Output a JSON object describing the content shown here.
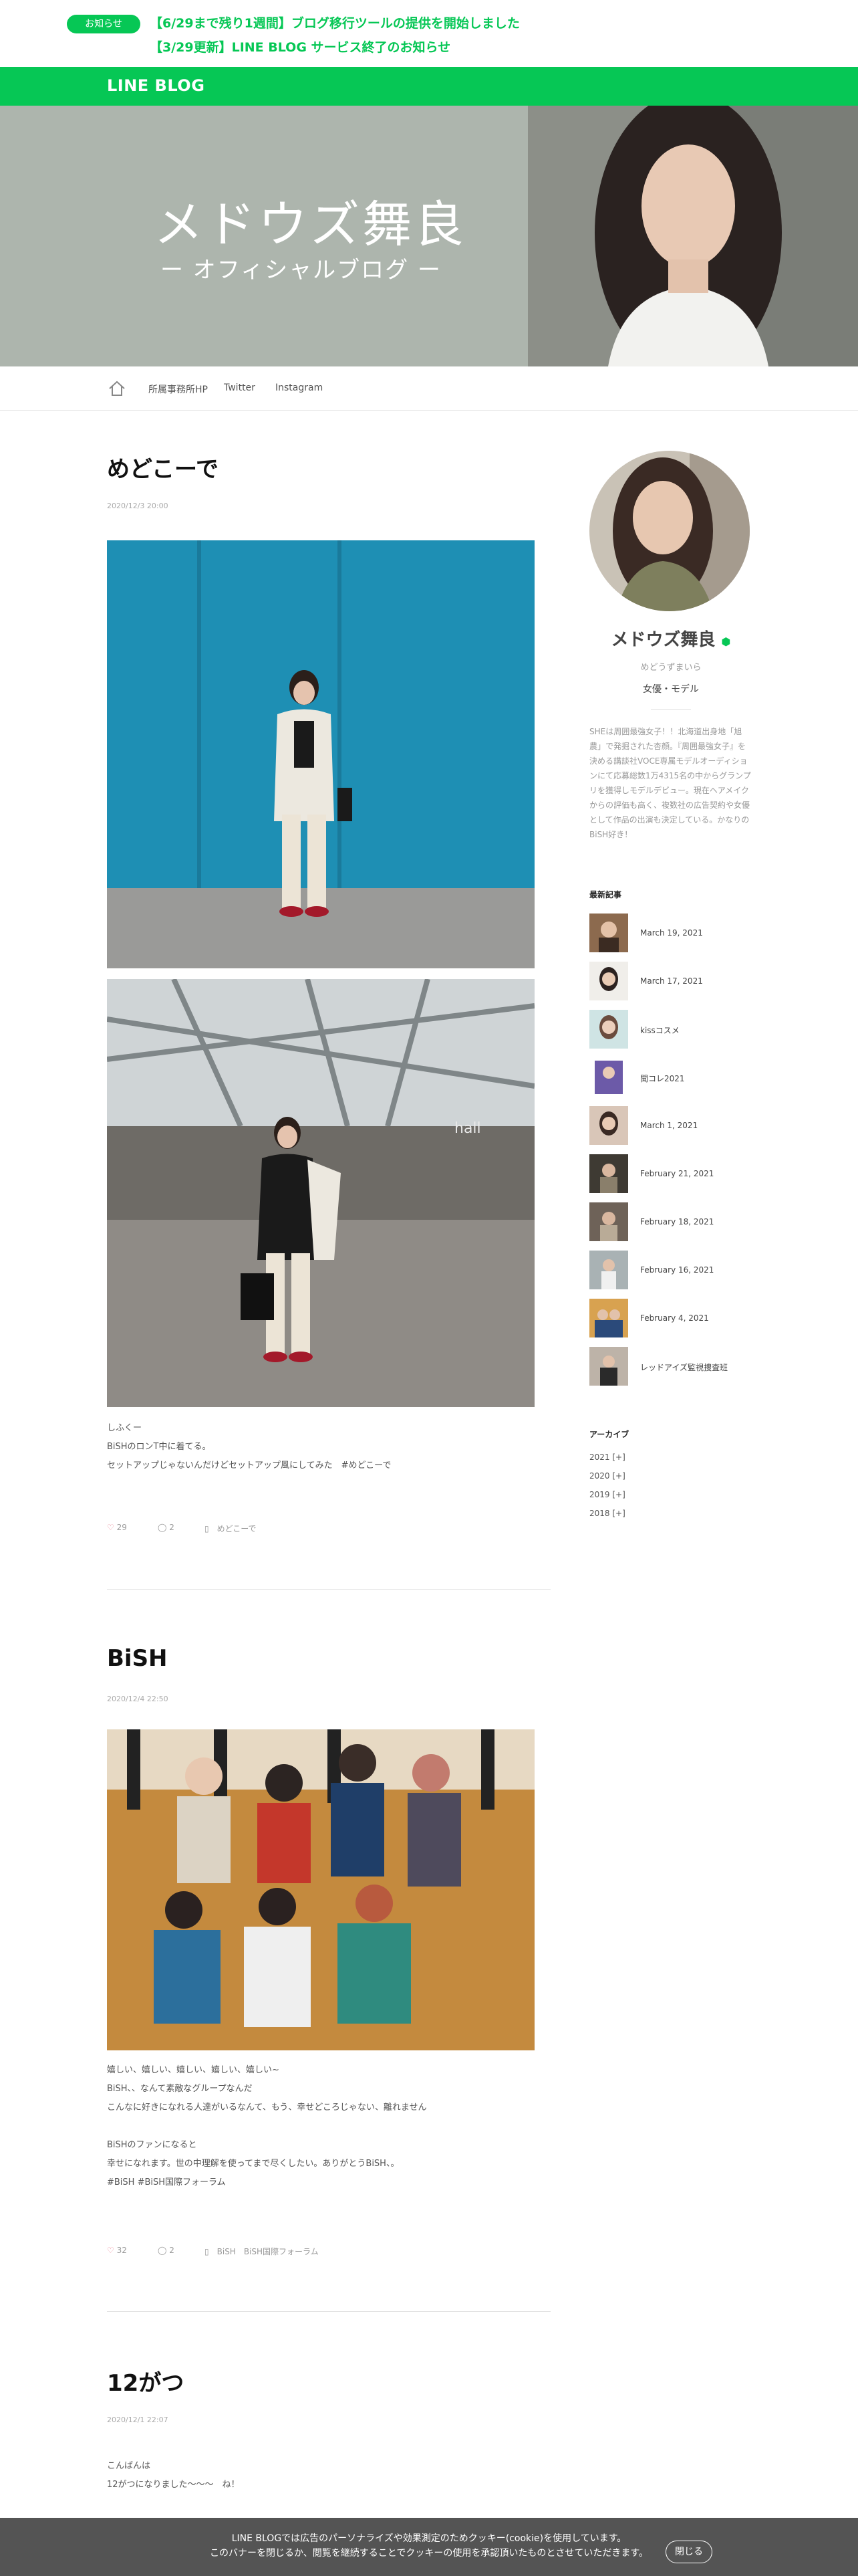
{
  "notice": {
    "badge": "お知らせ",
    "line1": "【6/29まで残り1週間】ブログ移行ツールの提供を開始しました",
    "line2": "【3/29更新】LINE BLOG サービス終了のお知らせ"
  },
  "header": {
    "logo": "LINE BLOG"
  },
  "hero": {
    "title": "メドウズ舞良",
    "subtitle": "ー オフィシャルブログ ー",
    "bg_color": "#adb5ad"
  },
  "nav": {
    "home_icon": "home-icon",
    "links": [
      "所属事務所HP",
      "Twitter",
      "Instagram"
    ]
  },
  "posts": [
    {
      "title": "めどこーで",
      "date": "2020/12/3 20:00",
      "text": [
        "しふくー",
        "BiSHのロンT中に着てる。",
        "セットアップじゃないんだけどセットアップ風にしてみた　#めどこーで"
      ],
      "likes": "29",
      "comments": "2",
      "tags": "めどこーで"
    },
    {
      "title": "BiSH",
      "date": "2020/12/4 22:50",
      "text": [
        "嬉しい、嬉しい、嬉しい、嬉しい、嬉しい~",
        "BiSH、、なんて素敵なグループなんだ",
        "こんなに好きになれる人達がいるなんて、もう、幸せどころじゃない、離れません",
        "",
        "BiSHのファンになると",
        "幸せになれます。世の中理解を使ってまで尽くしたい。ありがとうBiSH、。",
        "#BiSH #BiSH国際フォーラム"
      ],
      "likes": "32",
      "comments": "2",
      "tags": "BiSH　BiSH国際フォーラム"
    },
    {
      "title": "12がつ",
      "date": "2020/12/1 22:07",
      "text": [
        "こんばんは",
        "12がつになりました〜〜〜　ね！"
      ]
    }
  ],
  "profile": {
    "name": "メドウズ舞良",
    "kana": "めどうずまいら",
    "category": "女優・モデル",
    "description": "SHEは周囲最強女子！！北海道出身地「旭農」で発掘された杏顔。『周囲最強女子』を決める講談社VOCE専属モデルオーディションにて応募総数1万4315名の中からグランプリを獲得しモデルデビュー。現在ヘアメイクからの評価も高く、複数社の広告契約や女優として作品の出演も決定している。かなりのBiSH好き！"
  },
  "recent": {
    "heading": "最新記事",
    "items": [
      "March 19, 2021",
      "March 17, 2021",
      "kissコスメ",
      "聞コレ2021",
      "March 1, 2021",
      "February 21, 2021",
      "February 18, 2021",
      "February 16, 2021",
      "February 4, 2021",
      "レッドアイズ監視捜査班"
    ]
  },
  "archive": {
    "heading": "アーカイブ",
    "items": [
      "2021 [+]",
      "2020 [+]",
      "2019 [+]",
      "2018 [+]"
    ]
  },
  "cookie": {
    "line1": "LINE BLOGでは広告のパーソナライズや効果測定のためクッキー(cookie)を使用しています。",
    "line2": "このバナーを閉じるか、閲覧を継続することでクッキーの使用を承認頂いたものとさせていただきます。",
    "close": "閉じる"
  },
  "colors": {
    "accent": "#06c755",
    "cookie_bg": "#545454"
  }
}
